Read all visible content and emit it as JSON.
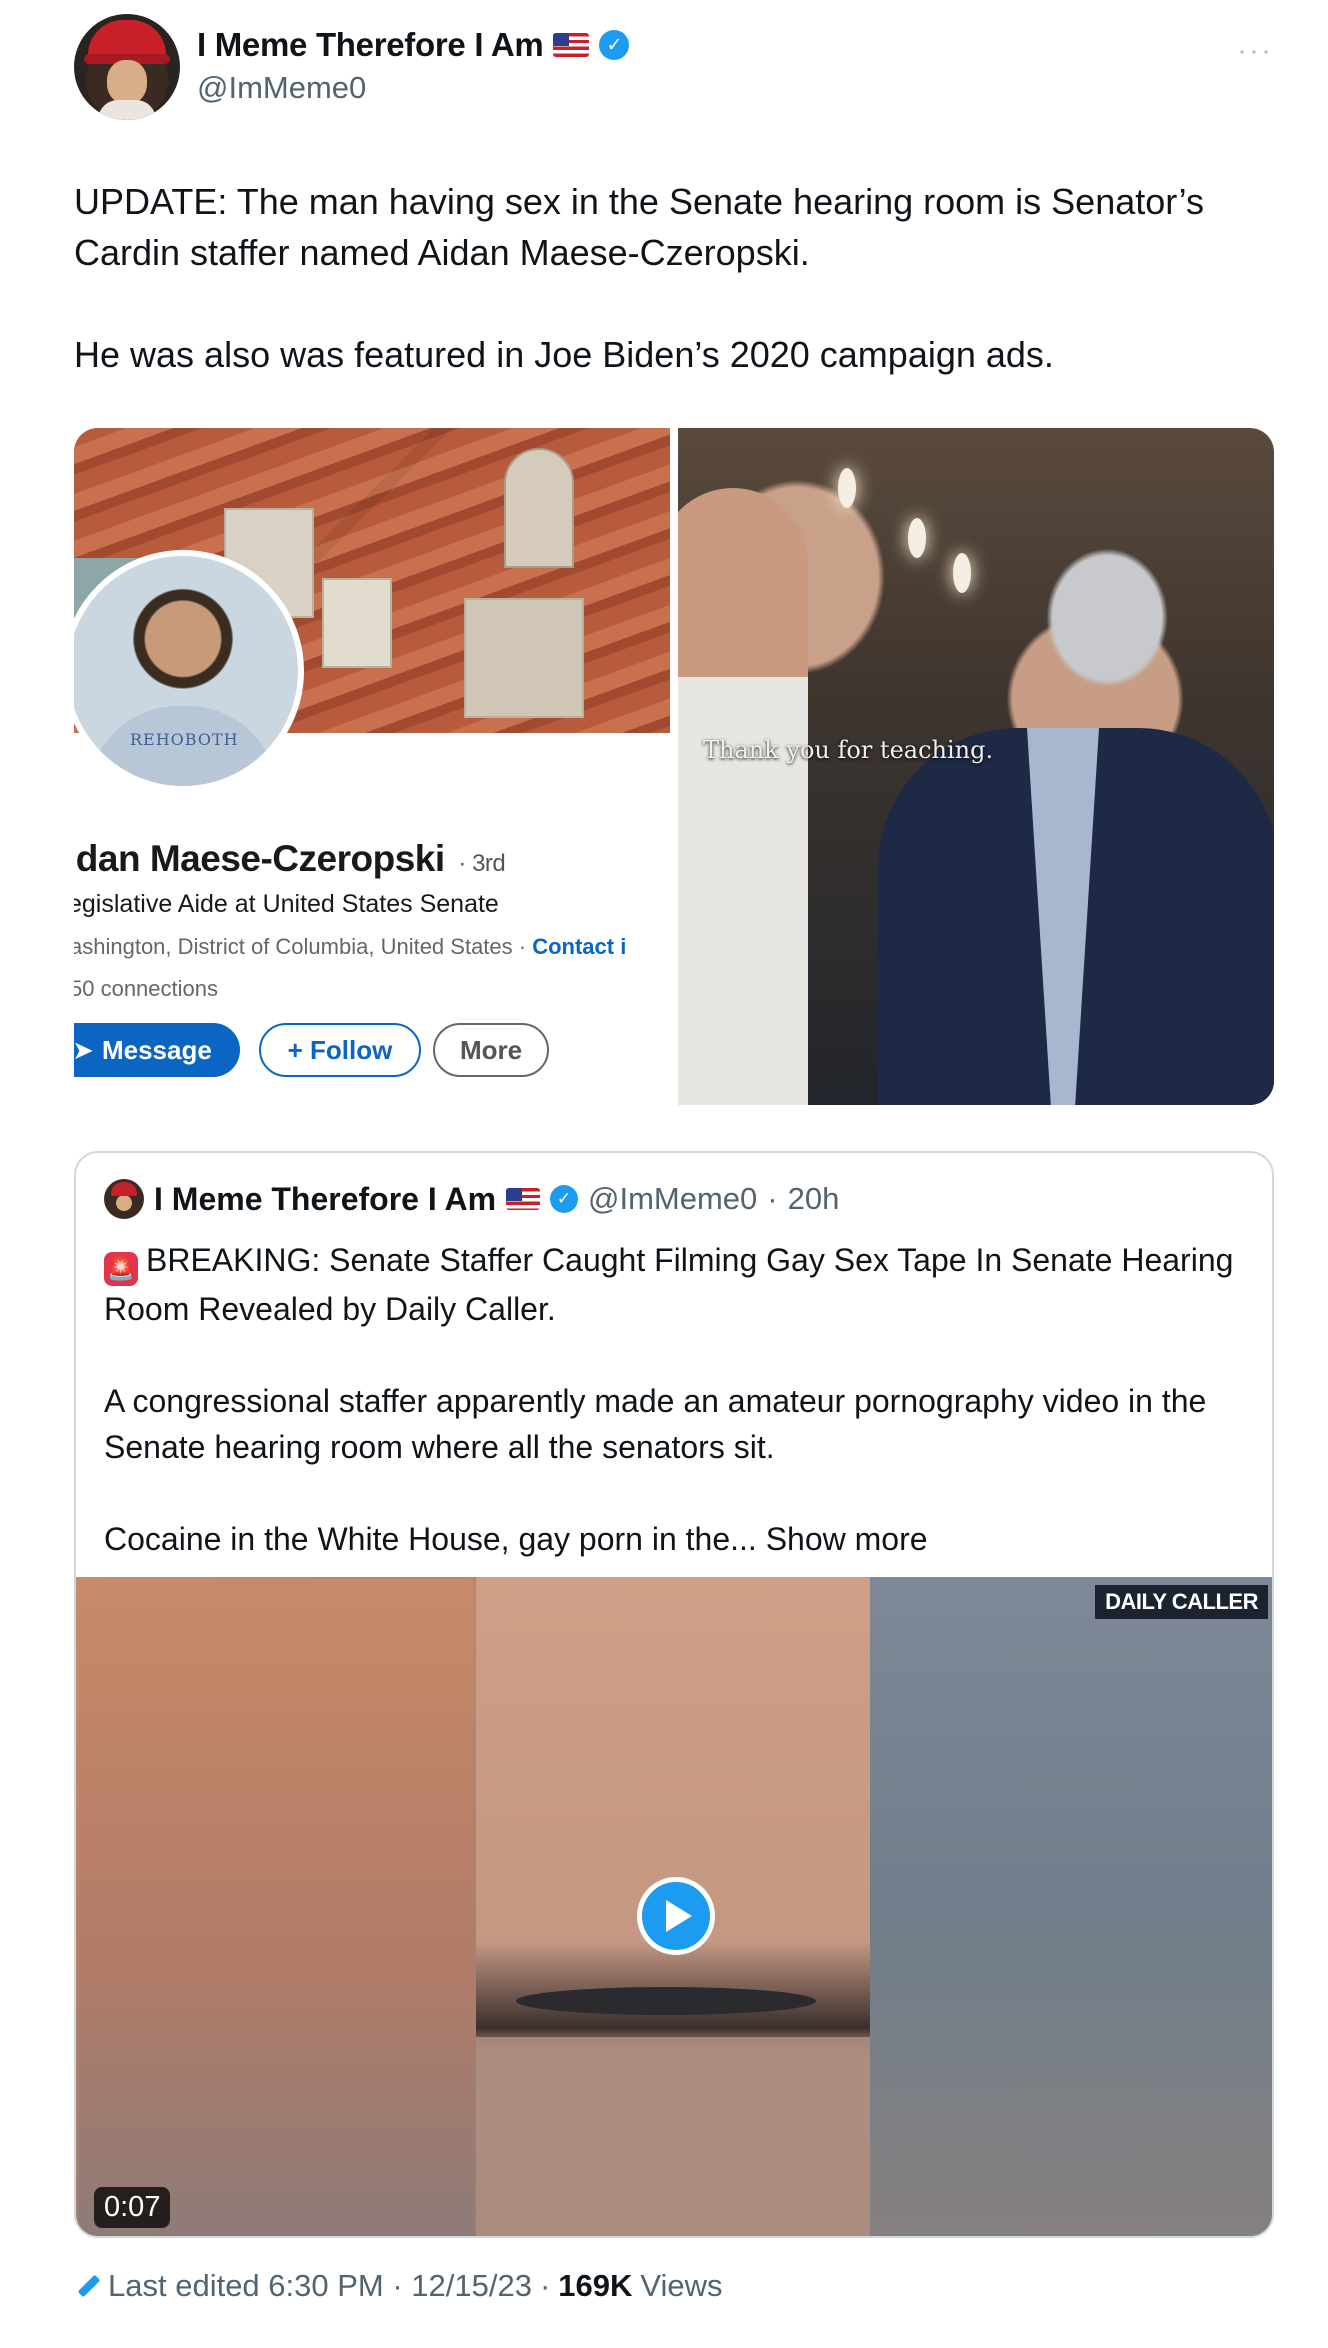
{
  "author": {
    "display_name": "I Meme Therefore I Am",
    "handle": "@ImMeme0",
    "verified": true
  },
  "tweet": {
    "paragraph1": "UPDATE: The man having sex in  the Senate hearing room is Senator’s Cardin staffer named Aidan Maese-Czeropski.",
    "paragraph2": "He was also was featured in Joe Biden’s 2020 campaign ads."
  },
  "media_left": {
    "name": "idan Maese-Czeropski",
    "degree": "· 3rd",
    "title": "egislative Aide at United States Senate",
    "location": "ashington, District of Columbia, United States · ",
    "contact": "Contact i",
    "connections": "50 connections",
    "shirt_text": "REHOBOTH",
    "buttons": {
      "message": "Message",
      "follow": "+ Follow",
      "more": "More"
    }
  },
  "media_right": {
    "caption": "Thank you for teaching."
  },
  "quote": {
    "display_name": "I Meme Therefore I Am",
    "handle": "@ImMeme0",
    "separator": "·",
    "time": "20h",
    "paragraph1": "BREAKING: Senate Staffer Caught Filming Gay Sex Tape In Senate Hearing Room Revealed by Daily Caller.",
    "paragraph2": "A congressional staffer apparently made an amateur pornography video in the Senate hearing room where all the senators sit.",
    "paragraph3_prefix": "Cocaine in the White House, gay porn in the... ",
    "show_more": "Show more",
    "video": {
      "watermark": "DAILY CALLER",
      "duration": "0:07"
    }
  },
  "footer": {
    "edited": "Last edited 6:30 PM · 12/15/23",
    "separator": "·",
    "views_count": "169K",
    "views_label": "Views"
  },
  "colors": {
    "accent": "#1d9bf0",
    "text": "#0f1419",
    "muted": "#536471",
    "linkedin_blue": "#0a66c2"
  }
}
